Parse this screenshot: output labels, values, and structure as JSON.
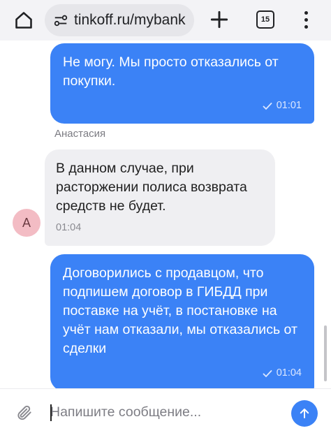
{
  "browser": {
    "url": "tinkoff.ru/mybank",
    "tab_count": "15",
    "icons": [
      "home-icon",
      "site-settings-icon",
      "plus-icon",
      "tabs-icon",
      "more-vert-icon"
    ]
  },
  "chat": {
    "messages": [
      {
        "direction": "outgoing",
        "text": "Не могу. Мы просто отказались от покупки.",
        "time": "01:01",
        "status": "read"
      },
      {
        "direction": "incoming",
        "sender": "Анастасия",
        "avatar_letter": "А",
        "text": "В данном случае, при расторжении полиса возврата средств не будет.",
        "time": "01:04"
      },
      {
        "direction": "outgoing",
        "text": "Договорились с продавцом, что подпишем договор в ГИБДД при поставке на учёт, в постановке на учёт нам отказали, мы отказались от сделки",
        "time": "01:04",
        "status": "read"
      }
    ]
  },
  "composer": {
    "placeholder": "Напишите сообщение...",
    "icons": [
      "paperclip-icon",
      "arrow-up-icon"
    ]
  },
  "colors": {
    "accent": "#3b82f6",
    "incoming_bubble": "#efeff2",
    "avatar_bg": "#f3bcc4"
  }
}
